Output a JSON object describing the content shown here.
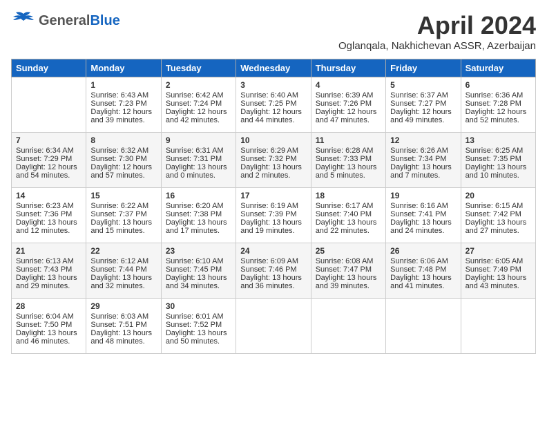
{
  "header": {
    "logo_general": "General",
    "logo_blue": "Blue",
    "title": "April 2024",
    "location": "Oglanqala, Nakhichevan ASSR, Azerbaijan"
  },
  "days_header": [
    "Sunday",
    "Monday",
    "Tuesday",
    "Wednesday",
    "Thursday",
    "Friday",
    "Saturday"
  ],
  "weeks": [
    [
      {
        "day": "",
        "info": ""
      },
      {
        "day": "1",
        "info": "Sunrise: 6:43 AM\nSunset: 7:23 PM\nDaylight: 12 hours\nand 39 minutes."
      },
      {
        "day": "2",
        "info": "Sunrise: 6:42 AM\nSunset: 7:24 PM\nDaylight: 12 hours\nand 42 minutes."
      },
      {
        "day": "3",
        "info": "Sunrise: 6:40 AM\nSunset: 7:25 PM\nDaylight: 12 hours\nand 44 minutes."
      },
      {
        "day": "4",
        "info": "Sunrise: 6:39 AM\nSunset: 7:26 PM\nDaylight: 12 hours\nand 47 minutes."
      },
      {
        "day": "5",
        "info": "Sunrise: 6:37 AM\nSunset: 7:27 PM\nDaylight: 12 hours\nand 49 minutes."
      },
      {
        "day": "6",
        "info": "Sunrise: 6:36 AM\nSunset: 7:28 PM\nDaylight: 12 hours\nand 52 minutes."
      }
    ],
    [
      {
        "day": "7",
        "info": "Sunrise: 6:34 AM\nSunset: 7:29 PM\nDaylight: 12 hours\nand 54 minutes."
      },
      {
        "day": "8",
        "info": "Sunrise: 6:32 AM\nSunset: 7:30 PM\nDaylight: 12 hours\nand 57 minutes."
      },
      {
        "day": "9",
        "info": "Sunrise: 6:31 AM\nSunset: 7:31 PM\nDaylight: 13 hours\nand 0 minutes."
      },
      {
        "day": "10",
        "info": "Sunrise: 6:29 AM\nSunset: 7:32 PM\nDaylight: 13 hours\nand 2 minutes."
      },
      {
        "day": "11",
        "info": "Sunrise: 6:28 AM\nSunset: 7:33 PM\nDaylight: 13 hours\nand 5 minutes."
      },
      {
        "day": "12",
        "info": "Sunrise: 6:26 AM\nSunset: 7:34 PM\nDaylight: 13 hours\nand 7 minutes."
      },
      {
        "day": "13",
        "info": "Sunrise: 6:25 AM\nSunset: 7:35 PM\nDaylight: 13 hours\nand 10 minutes."
      }
    ],
    [
      {
        "day": "14",
        "info": "Sunrise: 6:23 AM\nSunset: 7:36 PM\nDaylight: 13 hours\nand 12 minutes."
      },
      {
        "day": "15",
        "info": "Sunrise: 6:22 AM\nSunset: 7:37 PM\nDaylight: 13 hours\nand 15 minutes."
      },
      {
        "day": "16",
        "info": "Sunrise: 6:20 AM\nSunset: 7:38 PM\nDaylight: 13 hours\nand 17 minutes."
      },
      {
        "day": "17",
        "info": "Sunrise: 6:19 AM\nSunset: 7:39 PM\nDaylight: 13 hours\nand 19 minutes."
      },
      {
        "day": "18",
        "info": "Sunrise: 6:17 AM\nSunset: 7:40 PM\nDaylight: 13 hours\nand 22 minutes."
      },
      {
        "day": "19",
        "info": "Sunrise: 6:16 AM\nSunset: 7:41 PM\nDaylight: 13 hours\nand 24 minutes."
      },
      {
        "day": "20",
        "info": "Sunrise: 6:15 AM\nSunset: 7:42 PM\nDaylight: 13 hours\nand 27 minutes."
      }
    ],
    [
      {
        "day": "21",
        "info": "Sunrise: 6:13 AM\nSunset: 7:43 PM\nDaylight: 13 hours\nand 29 minutes."
      },
      {
        "day": "22",
        "info": "Sunrise: 6:12 AM\nSunset: 7:44 PM\nDaylight: 13 hours\nand 32 minutes."
      },
      {
        "day": "23",
        "info": "Sunrise: 6:10 AM\nSunset: 7:45 PM\nDaylight: 13 hours\nand 34 minutes."
      },
      {
        "day": "24",
        "info": "Sunrise: 6:09 AM\nSunset: 7:46 PM\nDaylight: 13 hours\nand 36 minutes."
      },
      {
        "day": "25",
        "info": "Sunrise: 6:08 AM\nSunset: 7:47 PM\nDaylight: 13 hours\nand 39 minutes."
      },
      {
        "day": "26",
        "info": "Sunrise: 6:06 AM\nSunset: 7:48 PM\nDaylight: 13 hours\nand 41 minutes."
      },
      {
        "day": "27",
        "info": "Sunrise: 6:05 AM\nSunset: 7:49 PM\nDaylight: 13 hours\nand 43 minutes."
      }
    ],
    [
      {
        "day": "28",
        "info": "Sunrise: 6:04 AM\nSunset: 7:50 PM\nDaylight: 13 hours\nand 46 minutes."
      },
      {
        "day": "29",
        "info": "Sunrise: 6:03 AM\nSunset: 7:51 PM\nDaylight: 13 hours\nand 48 minutes."
      },
      {
        "day": "30",
        "info": "Sunrise: 6:01 AM\nSunset: 7:52 PM\nDaylight: 13 hours\nand 50 minutes."
      },
      {
        "day": "",
        "info": ""
      },
      {
        "day": "",
        "info": ""
      },
      {
        "day": "",
        "info": ""
      },
      {
        "day": "",
        "info": ""
      }
    ]
  ]
}
